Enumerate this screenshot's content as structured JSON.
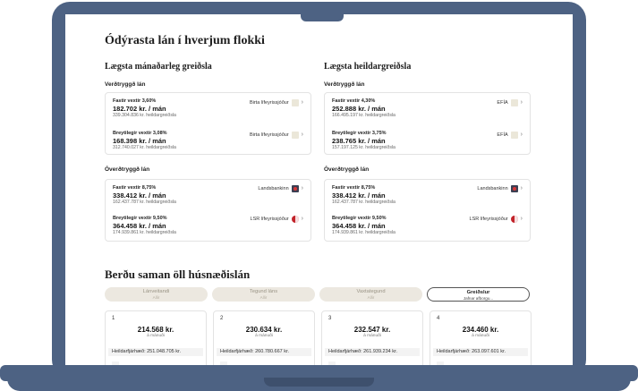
{
  "page_title": "Ódýrasta lán í hverjum flokki",
  "sections": {
    "monthly": {
      "title": "Lægsta mánaðarleg greiðsla",
      "groups": [
        {
          "title": "Verðtryggð lán",
          "offers": [
            {
              "rate": "Fastir vextir 3,60%",
              "monthly": "182.702 kr. / mán",
              "total": "339.304.836 kr. heildargreiðsla",
              "lender": "Birta lífeyrissjóður",
              "logo": "beige-square-logo"
            },
            {
              "rate": "Breytilegir vextir 3,08%",
              "monthly": "168.398 kr. / mán",
              "total": "312.740.027 kr. heildargreiðsla",
              "lender": "Birta lífeyrissjóður",
              "logo": "beige-square-logo"
            }
          ]
        },
        {
          "title": "Óverðtryggð lán",
          "offers": [
            {
              "rate": "Fastir vextir 8,75%",
              "monthly": "338.412 kr. / mán",
              "total": "162.437.787 kr. heildargreiðsla",
              "lender": "Landsbankinn",
              "logo": "landsbankinn-logo"
            },
            {
              "rate": "Breytilegir vextir 9,50%",
              "monthly": "364.458 kr. / mán",
              "total": "174.939.861 kr. heildargreiðsla",
              "lender": "LSR lífeyrissjóður",
              "logo": "lsr-logo"
            }
          ]
        }
      ]
    },
    "total": {
      "title": "Lægsta heildargreiðsla",
      "groups": [
        {
          "title": "Verðtryggð lán",
          "offers": [
            {
              "rate": "Fastir vextir 4,30%",
              "monthly": "252.888 kr. / mán",
              "total": "166.495.197 kr. heildargreiðsla",
              "lender": "EFÍA",
              "logo": "beige-square-logo"
            },
            {
              "rate": "Breytilegir vextir 3,75%",
              "monthly": "238.765 kr. / mán",
              "total": "157.197.125 kr. heildargreiðsla",
              "lender": "EFÍA",
              "logo": "beige-square-logo"
            }
          ]
        },
        {
          "title": "Óverðtryggð lán",
          "offers": [
            {
              "rate": "Fastir vextir 8,75%",
              "monthly": "338.412 kr. / mán",
              "total": "162.437.787 kr. heildargreiðsla",
              "lender": "Landsbankinn",
              "logo": "landsbankinn-logo"
            },
            {
              "rate": "Breytilegir vextir 9,50%",
              "monthly": "364.458 kr. / mán",
              "total": "174.939.861 kr. heildargreiðsla",
              "lender": "LSR lífeyrissjóður",
              "logo": "lsr-logo"
            }
          ]
        }
      ]
    }
  },
  "compare": {
    "title": "Berðu saman öll húsnæðislán",
    "filters": [
      {
        "label": "Lánveitandi",
        "value": "Allir"
      },
      {
        "label": "Tegund láns",
        "value": "Allir"
      },
      {
        "label": "Vaxtategund",
        "value": "Allir"
      },
      {
        "label": "Greiðslur",
        "value": "Jafnar afborgu..."
      }
    ],
    "results": [
      {
        "index": "1",
        "amount": "214.568 kr.",
        "sub": "á mánuði",
        "total": "Heildarfjárhæð: 251.048.705 kr."
      },
      {
        "index": "2",
        "amount": "230.634 kr.",
        "sub": "á mánuði",
        "total": "Heildarfjárhæð: 260.780.667 kr."
      },
      {
        "index": "3",
        "amount": "232.547 kr.",
        "sub": "á mánuði",
        "total": "Heildarfjárhæð: 261.939.234 kr."
      },
      {
        "index": "4",
        "amount": "234.460 kr.",
        "sub": "á mánuði",
        "total": "Heildarfjárhæð: 263.097.601 kr."
      }
    ]
  },
  "colors": {
    "device_frame": "#4d6283",
    "filter_bg": "#ece8e0",
    "card_border": "#e3e3e3"
  }
}
